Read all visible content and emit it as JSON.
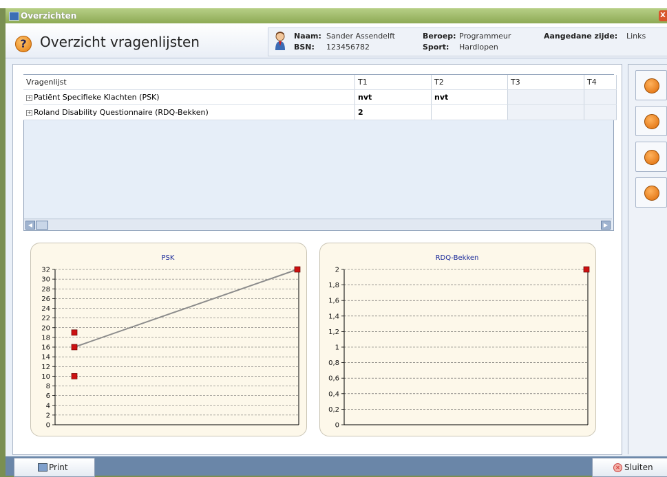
{
  "window": {
    "title": "Overzichten",
    "close_label": "X"
  },
  "header": {
    "page_title": "Overzicht vragenlijsten",
    "patient": {
      "naam_label": "Naam:",
      "naam_value": "Sander Assendelft",
      "bsn_label": "BSN:",
      "bsn_value": "123456782",
      "beroep_label": "Beroep:",
      "beroep_value": "Programmeur",
      "sport_label": "Sport:",
      "sport_value": "Hardlopen",
      "zijde_label": "Aangedane zijde:",
      "zijde_value": "Links"
    }
  },
  "table": {
    "columns": [
      "Vragenlijst",
      "T1",
      "T2",
      "T3",
      "T4"
    ],
    "rows": [
      {
        "name": "Patiënt Specifieke Klachten (PSK)",
        "T1": "nvt",
        "T2": "nvt",
        "T3": "",
        "T4": ""
      },
      {
        "name": "Roland Disability Questionnaire (RDQ-Bekken)",
        "T1": "2",
        "T2": "",
        "T3": "",
        "T4": ""
      }
    ],
    "expand_icon": "plus-box-icon"
  },
  "chart_data": [
    {
      "type": "scatter",
      "title": "PSK",
      "ylim": [
        0,
        32
      ],
      "yticks": [
        "0",
        "2",
        "4",
        "6",
        "8",
        "10",
        "12",
        "14",
        "16",
        "18",
        "20",
        "22",
        "24",
        "26",
        "28",
        "30",
        "32"
      ],
      "points": [
        {
          "x": 1,
          "y": 19
        },
        {
          "x": 1,
          "y": 16
        },
        {
          "x": 1,
          "y": 10
        },
        {
          "x": 2,
          "y": 32
        }
      ],
      "line": [
        {
          "x": 1,
          "y": 16
        },
        {
          "x": 2,
          "y": 32
        }
      ],
      "grid": true,
      "marker_color": "#cc1111",
      "line_color": "#8c8c8c"
    },
    {
      "type": "scatter",
      "title": "RDQ-Bekken",
      "ylim": [
        0,
        2
      ],
      "yticks": [
        "0",
        "0,2",
        "0,4",
        "0,6",
        "0,8",
        "1",
        "1,2",
        "1,4",
        "1,6",
        "1,8",
        "2"
      ],
      "points": [
        {
          "x": 2,
          "y": 2
        }
      ],
      "grid": true,
      "marker_color": "#cc1111"
    }
  ],
  "sidebar_buttons": [
    {
      "icon": "help-icon"
    },
    {
      "icon": "ruler-icon"
    },
    {
      "icon": "home-icon"
    },
    {
      "icon": "monitor-icon"
    }
  ],
  "footer": {
    "print_label": "Print",
    "close_label": "Sluiten"
  },
  "colors": {
    "titlebar": "#9cb866",
    "accent_orange": "#e27d10",
    "footer": "#6a86a8"
  }
}
